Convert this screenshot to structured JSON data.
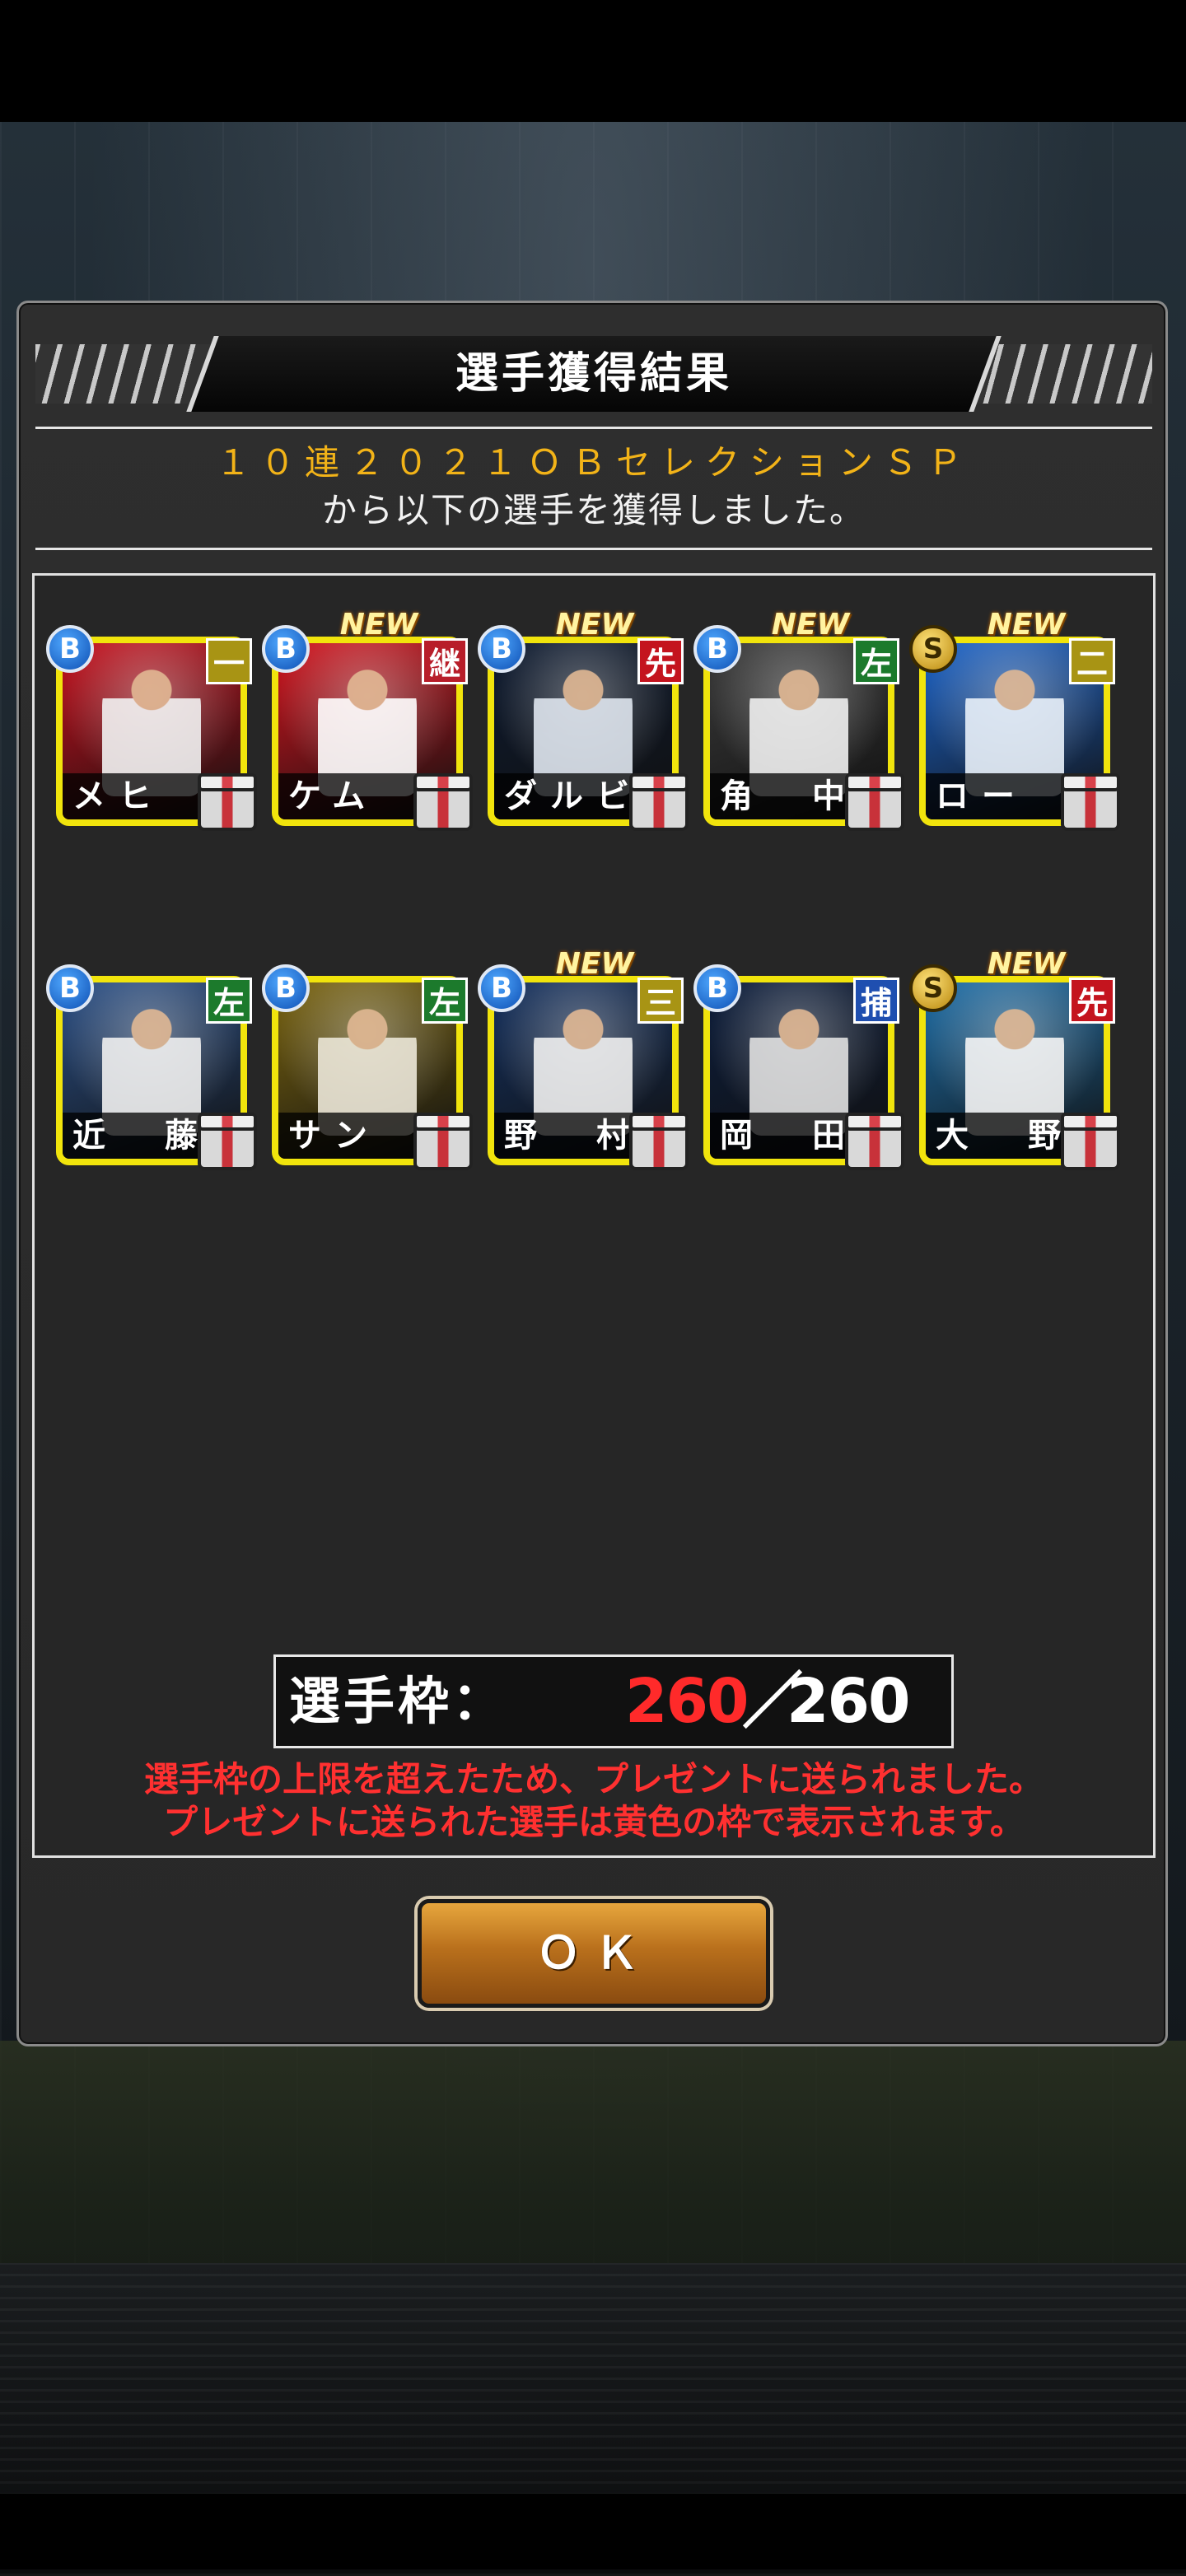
{
  "dialog": {
    "title": "選手獲得結果",
    "gacha_name": "１０連２０２１ＯＢセレクションＳＰ",
    "gacha_suffix": "から以下の選手を獲得しました。",
    "quota_label": "選手枠：",
    "quota_current": "260",
    "quota_separator": "／",
    "quota_max": "260",
    "warning_line1": "選手枠の上限を超えたため、プレゼントに送られました。",
    "warning_line2": "プレゼントに送られた選手は黄色の枠で表示されます。",
    "ok_label": "ＯＫ"
  },
  "players": [
    {
      "name": "メヒ",
      "rank": "B",
      "position": "一",
      "is_new": false,
      "pos_color": "#a89414",
      "photo": [
        "#c8101d",
        "#f2f2f2"
      ]
    },
    {
      "name": "ケム",
      "rank": "B",
      "position": "継",
      "is_new": true,
      "pos_color": "#b81e2a",
      "photo": [
        "#d3141e",
        "#ffffff"
      ]
    },
    {
      "name": "ダルビッシ",
      "rank": "B",
      "position": "先",
      "is_new": true,
      "pos_color": "#c4141e",
      "photo": [
        "#0d1a30",
        "#dfe6ef"
      ]
    },
    {
      "name": "角　中",
      "rank": "B",
      "position": "左",
      "is_new": true,
      "pos_color": "#1c7a2c",
      "photo": [
        "#3a3a3a",
        "#f0f0f0"
      ]
    },
    {
      "name": "ロー",
      "rank": "S",
      "position": "二",
      "is_new": true,
      "pos_color": "#a89414",
      "photo": [
        "#1b63c9",
        "#e9f1fa"
      ]
    },
    {
      "name": "近　藤",
      "rank": "B",
      "position": "左",
      "is_new": false,
      "pos_color": "#1c7a2c",
      "photo": [
        "#2a4f86",
        "#f0f0f0"
      ]
    },
    {
      "name": "サン",
      "rank": "B",
      "position": "左",
      "is_new": false,
      "pos_color": "#1c7a2c",
      "photo": [
        "#7a6410",
        "#ece7d8"
      ]
    },
    {
      "name": "野　村",
      "rank": "B",
      "position": "三",
      "is_new": true,
      "pos_color": "#a89414",
      "photo": [
        "#14305e",
        "#f0f0f0"
      ]
    },
    {
      "name": "岡　田",
      "rank": "B",
      "position": "捕",
      "is_new": false,
      "pos_color": "#1f4fb0",
      "photo": [
        "#0c1d3c",
        "#e0e0e0"
      ]
    },
    {
      "name": "大　野",
      "rank": "S",
      "position": "先",
      "is_new": true,
      "pos_color": "#c4141e",
      "photo": [
        "#1d6ea8",
        "#f5f5f5"
      ]
    }
  ],
  "new_badge_label": "NEW",
  "colors": {
    "card_frame": "#f1e40c",
    "gold_text": "#f2b318",
    "warning_text": "#ff3030",
    "quota_current": "#ff2a2a"
  },
  "icons": [
    "gift-icon",
    "rank-b-badge",
    "rank-s-badge"
  ]
}
